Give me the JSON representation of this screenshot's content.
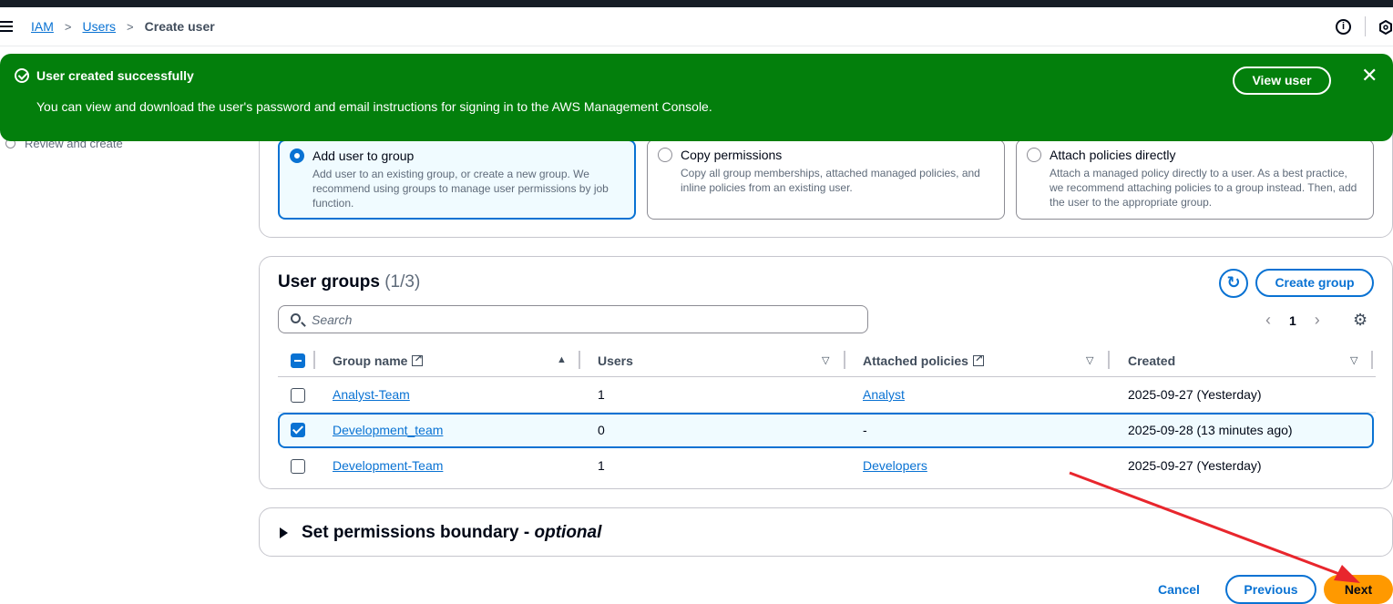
{
  "breadcrumb": {
    "items": [
      "IAM",
      "Users",
      "Create user"
    ]
  },
  "flash": {
    "title": "User created successfully",
    "message": "You can view and download the user's password and email instructions for signing in to the AWS Management Console.",
    "view_button": "View user",
    "close": "✕"
  },
  "sidebar": {
    "step_label": "Review and create"
  },
  "permission_options": [
    {
      "title": "Add user to group",
      "description": "Add user to an existing group, or create a new group. We recommend using groups to manage user permissions by job function.",
      "selected": true
    },
    {
      "title": "Copy permissions",
      "description": "Copy all group memberships, attached managed policies, and inline policies from an existing user.",
      "selected": false
    },
    {
      "title": "Attach policies directly",
      "description": "Attach a managed policy directly to a user. As a best practice, we recommend attaching policies to a group instead. Then, add the user to the appropriate group.",
      "selected": false
    }
  ],
  "user_groups": {
    "title": "User groups",
    "count": "(1/3)",
    "create_button": "Create group",
    "search_placeholder": "Search",
    "page": "1",
    "columns": [
      "Group name",
      "Users",
      "Attached policies",
      "Created"
    ],
    "rows": [
      {
        "name": "Analyst-Team",
        "users": "1",
        "policies": "Analyst",
        "created": "2025-09-27 (Yesterday)",
        "checked": false
      },
      {
        "name": "Development_team",
        "users": "0",
        "policies": "-",
        "created": "2025-09-28 (13 minutes ago)",
        "checked": true
      },
      {
        "name": "Development-Team",
        "users": "1",
        "policies": "Developers",
        "created": "2025-09-27 (Yesterday)",
        "checked": false
      }
    ]
  },
  "boundary": {
    "title": "Set permissions boundary - ",
    "optional": "optional"
  },
  "footer": {
    "cancel": "Cancel",
    "previous": "Previous",
    "next": "Next"
  },
  "colors": {
    "accent": "#0972d3",
    "success": "#037f0c",
    "primary_button": "#ff9900",
    "annotation_arrow": "#e8262d"
  }
}
